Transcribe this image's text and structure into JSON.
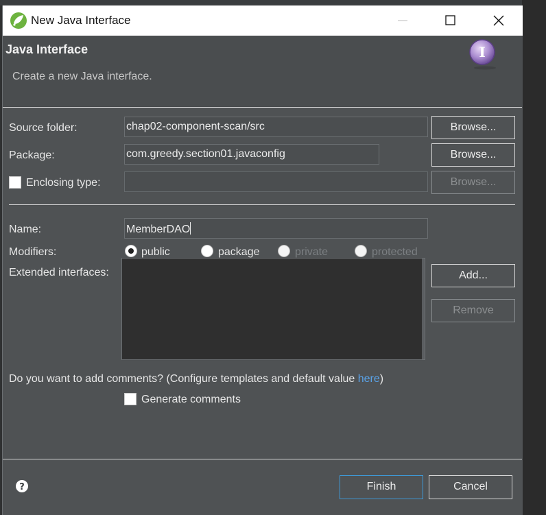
{
  "window": {
    "title": "New Java Interface"
  },
  "banner": {
    "title": "Java Interface",
    "subtitle": "Create a new Java interface.",
    "icon": "interface-I-icon"
  },
  "form": {
    "source_folder": {
      "label": "Source folder:",
      "value": "chap02-component-scan/src",
      "browse_label": "Browse..."
    },
    "package": {
      "label": "Package:",
      "value": "com.greedy.section01.javaconfig",
      "browse_label": "Browse..."
    },
    "enclosing_type": {
      "label": "Enclosing type:",
      "checked": false,
      "value": "",
      "browse_label": "Browse..."
    },
    "name": {
      "label": "Name:",
      "value": "MemberDAO"
    },
    "modifiers": {
      "label": "Modifiers:",
      "options": [
        {
          "label": "public",
          "selected": true,
          "enabled": true
        },
        {
          "label": "package",
          "selected": false,
          "enabled": true
        },
        {
          "label": "private",
          "selected": false,
          "enabled": false
        },
        {
          "label": "protected",
          "selected": false,
          "enabled": false
        }
      ]
    },
    "extended_interfaces": {
      "label": "Extended interfaces:",
      "add_label": "Add...",
      "remove_label": "Remove"
    },
    "comments": {
      "question": "Do you want to add comments? (Configure templates and default value ",
      "link": "here",
      "question_end": ")",
      "generate_label": "Generate comments",
      "generate_checked": false
    }
  },
  "footer": {
    "finish_label": "Finish",
    "cancel_label": "Cancel"
  },
  "colors": {
    "dialog_bg": "#4f5254",
    "link": "#5aa3e8",
    "primary_border": "#3e9ad8"
  }
}
